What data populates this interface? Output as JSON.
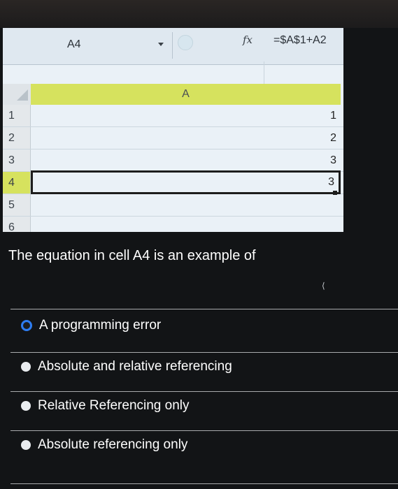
{
  "sheet": {
    "name_box": "A4",
    "fx_label": "fx",
    "formula": "=$A$1+A2",
    "column_header": "A",
    "rows": [
      {
        "num": "1",
        "value": "1"
      },
      {
        "num": "2",
        "value": "2"
      },
      {
        "num": "3",
        "value": "3"
      },
      {
        "num": "4",
        "value": "3"
      },
      {
        "num": "5",
        "value": ""
      },
      {
        "num": "6",
        "value": ""
      }
    ]
  },
  "quiz": {
    "question": "The equation in cell A4 is an example of",
    "options": [
      {
        "label": "A programming error",
        "selected": true
      },
      {
        "label": "Absolute and relative referencing",
        "selected": false
      },
      {
        "label": "Relative Referencing only",
        "selected": false
      },
      {
        "label": "Absolute referencing only",
        "selected": false
      }
    ]
  },
  "colors": {
    "header_highlight": "#d6e25e",
    "radio_selected": "#2e7df2"
  }
}
